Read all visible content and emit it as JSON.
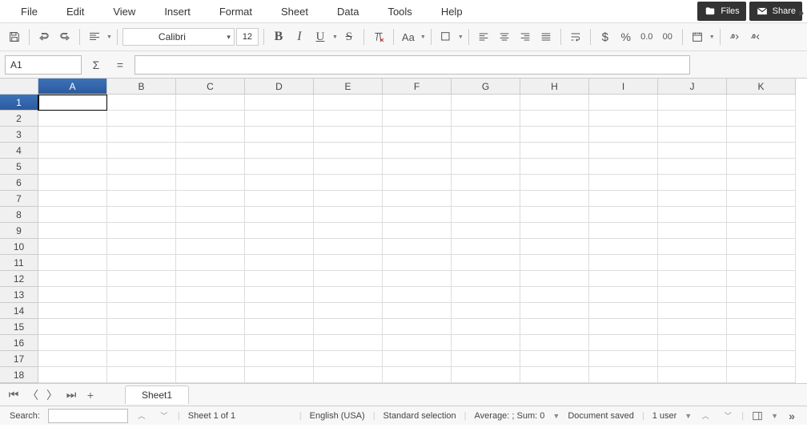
{
  "menu": {
    "file": "File",
    "edit": "Edit",
    "view": "View",
    "insert": "Insert",
    "format": "Format",
    "sheet": "Sheet",
    "data": "Data",
    "tools": "Tools",
    "help": "Help"
  },
  "topButtons": {
    "files": "Files",
    "share": "Share"
  },
  "toolbar": {
    "font": "Calibri",
    "fontSize": "12",
    "caseLabel": "Aa",
    "currency": "$",
    "percent": "%",
    "decimal": "0.0",
    "thousand": "00"
  },
  "formula": {
    "cellRef": "A1",
    "sigma": "Σ",
    "equals": "="
  },
  "columns": [
    "A",
    "B",
    "C",
    "D",
    "E",
    "F",
    "G",
    "H",
    "I",
    "J",
    "K"
  ],
  "rows": [
    "1",
    "2",
    "3",
    "4",
    "5",
    "6",
    "7",
    "8",
    "9",
    "10",
    "11",
    "12",
    "13",
    "14",
    "15",
    "16",
    "17",
    "18"
  ],
  "activeCell": {
    "row": 0,
    "col": 0
  },
  "tabs": {
    "sheet1": "Sheet1",
    "plus": "+"
  },
  "status": {
    "searchLabel": "Search:",
    "sheetCount": "Sheet 1 of 1",
    "language": "English (USA)",
    "selection": "Standard selection",
    "summary": "Average: ; Sum: 0",
    "saved": "Document saved",
    "users": "1 user"
  }
}
